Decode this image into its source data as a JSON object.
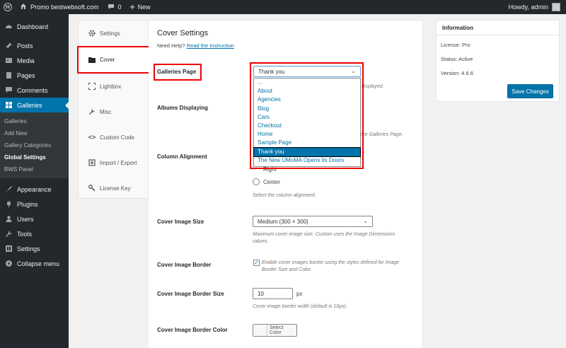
{
  "adminbar": {
    "site_name": "Promo bestwebsoft.com",
    "comments_count": "0",
    "new_label": "New",
    "howdy": "Howdy, admin"
  },
  "sidebar": {
    "items": [
      {
        "label": "Dashboard",
        "icon": "dashboard-icon"
      },
      {
        "label": "Posts",
        "icon": "pin-icon"
      },
      {
        "label": "Media",
        "icon": "media-icon"
      },
      {
        "label": "Pages",
        "icon": "page-icon"
      },
      {
        "label": "Comments",
        "icon": "comment-icon"
      },
      {
        "label": "Galleries",
        "icon": "gallery-icon"
      }
    ],
    "submenu": [
      "Galleries",
      "Add New",
      "Gallery Categories",
      "Global Settings",
      "BWS Panel"
    ],
    "items2": [
      {
        "label": "Appearance",
        "icon": "brush-icon"
      },
      {
        "label": "Plugins",
        "icon": "plug-icon"
      },
      {
        "label": "Users",
        "icon": "user-icon"
      },
      {
        "label": "Tools",
        "icon": "wrench-icon"
      },
      {
        "label": "Settings",
        "icon": "settings-icon"
      },
      {
        "label": "Collapse menu",
        "icon": "collapse-icon"
      }
    ]
  },
  "tabs": [
    {
      "label": "Settings",
      "icon": "gear-icon"
    },
    {
      "label": "Cover",
      "icon": "folder-icon"
    },
    {
      "label": "Lightbox",
      "icon": "expand-icon"
    },
    {
      "label": "Misc",
      "icon": "wrench-icon"
    },
    {
      "label": "Custom Code",
      "icon": "code-icon"
    },
    {
      "label": "Import / Export",
      "icon": "import-icon"
    },
    {
      "label": "License Key",
      "icon": "key-icon"
    }
  ],
  "main": {
    "title": "Cover Settings",
    "help_prefix": "Need Help?",
    "help_link": "Read the Instruction",
    "galleries_page": {
      "label": "Galleries Page",
      "selected": "Thank you",
      "desc_tail": "displayed.",
      "options": [
        "...",
        "About",
        "Agencies",
        "Blog",
        "Cars",
        "Checkout",
        "Home",
        "Sample Page",
        "Thank you",
        "The New UMoMA Opens its Doors"
      ]
    },
    "albums_displaying": {
      "label": "Albums Displaying",
      "desc_tail": "the Galleries Page."
    },
    "column_alignment": {
      "label": "Column Alignment",
      "option_right": "Right",
      "option_center": "Center",
      "desc": "Select the column alignment."
    },
    "cover_image_size": {
      "label": "Cover Image Size",
      "selected": "Medium (300 × 300)",
      "desc": "Maximum cover image size. Custom uses the Image Dimensions values."
    },
    "cover_image_border": {
      "label": "Cover Image Border",
      "desc": "Enable cover images border using the styles defined for Image Border Size and Color."
    },
    "cover_image_border_size": {
      "label": "Cover Image Border Size",
      "value": "10",
      "unit": "px",
      "desc": "Cover image border width (default is 10px)."
    },
    "cover_image_border_color": {
      "label": "Cover Image Border Color",
      "button": "Select Color"
    }
  },
  "info": {
    "title": "Information",
    "license": "License: Pro",
    "status": "Status: Active",
    "version": "Version: 4.6.6",
    "save_label": "Save Changes"
  }
}
